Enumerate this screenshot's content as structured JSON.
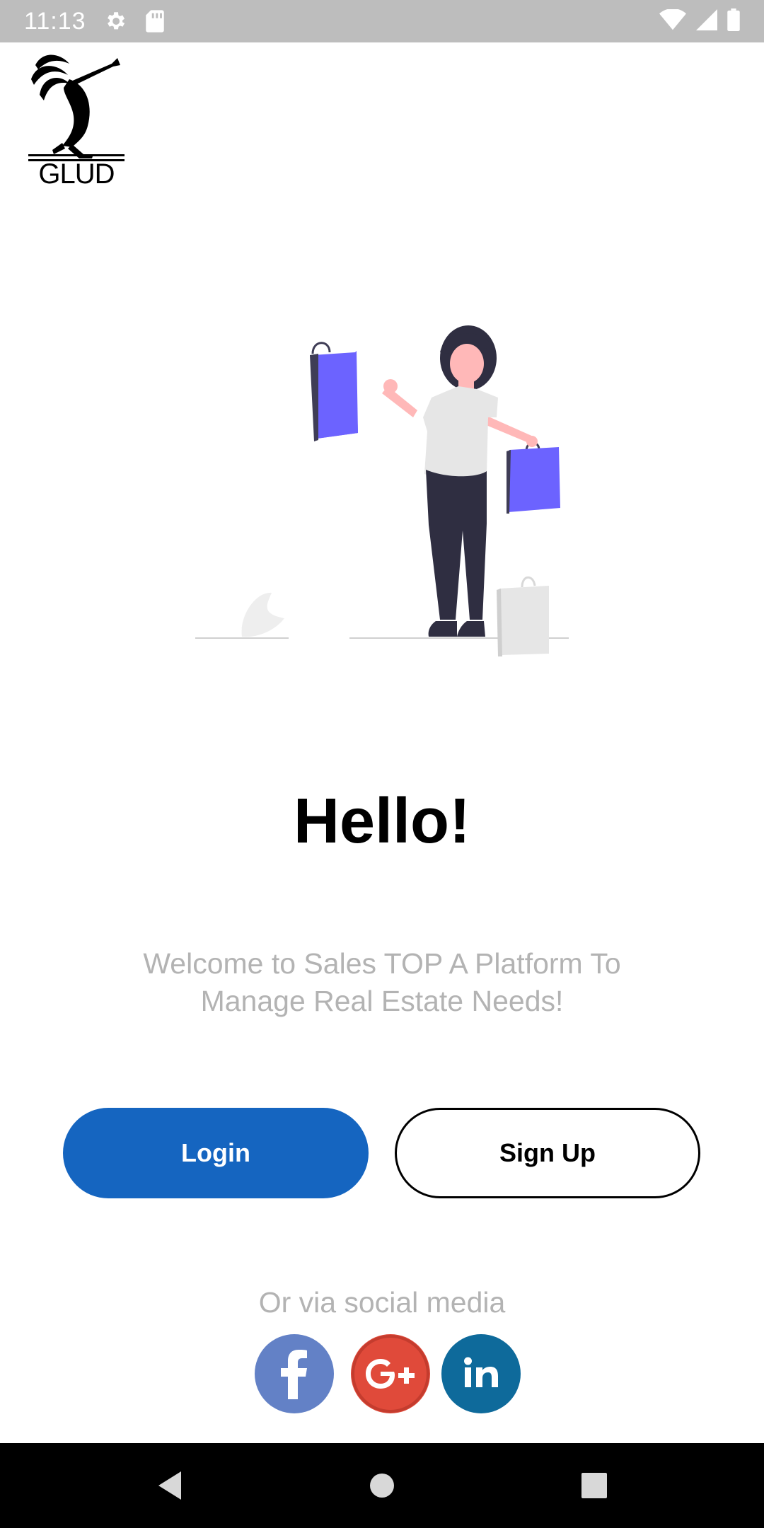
{
  "status_bar": {
    "time": "11:13",
    "icons": [
      "settings-icon",
      "sd-card-icon",
      "wifi-icon",
      "signal-icon",
      "battery-icon"
    ]
  },
  "logo": {
    "text": "GLUD"
  },
  "main": {
    "title": "Hello!",
    "welcome_text": "Welcome to Sales TOP A Platform To Manage Real Estate Needs!",
    "login_label": "Login",
    "signup_label": "Sign Up",
    "social_label": "Or via social media"
  },
  "social": [
    {
      "name": "facebook",
      "color": "#6381c6"
    },
    {
      "name": "google-plus",
      "color": "#e04a3a"
    },
    {
      "name": "linkedin",
      "color": "#0e6a9b"
    }
  ],
  "colors": {
    "primary": "#1565c0",
    "status_bar": "#bdbdbd",
    "muted_text": "#b3b3b3",
    "bag_purple": "#6c63ff"
  }
}
